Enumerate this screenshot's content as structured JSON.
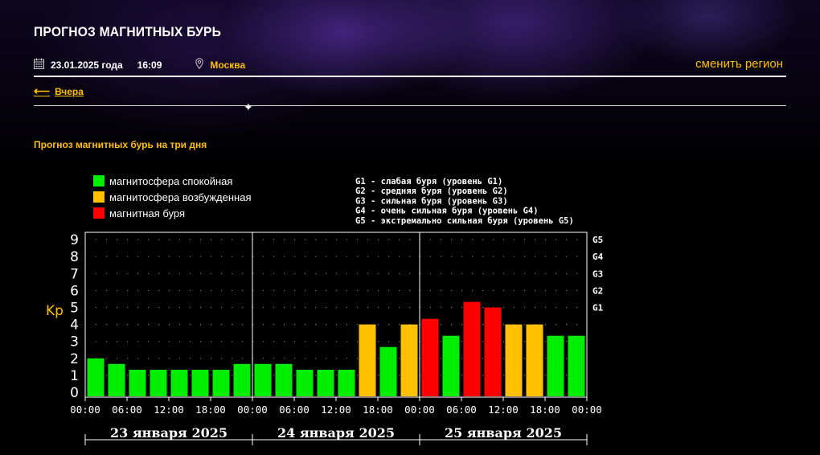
{
  "header": {
    "title": "ПРОГНОЗ МАГНИТНЫХ БУРЬ",
    "date": "23.01.2025 года",
    "time": "16:09",
    "city": "Москва",
    "change_region": "сменить регион",
    "back_label": "Вчера",
    "section_title": "Прогноз магнитных бурь на три дня"
  },
  "icons": {
    "calendar": "calendar-icon",
    "location": "location-pin-icon",
    "back": "left-arrow-icon"
  },
  "colors": {
    "accent": "#ffc000",
    "calm": "#00ee00",
    "excited": "#ffc000",
    "storm": "#ff0000"
  },
  "chart_data": {
    "type": "bar",
    "ylabel": "Kp",
    "ylim": [
      0,
      9
    ],
    "yticks": [
      "0",
      "1",
      "2",
      "3",
      "4",
      "5",
      "6",
      "7",
      "8",
      "9"
    ],
    "g_levels": [
      {
        "kp": 5,
        "label": "G1"
      },
      {
        "kp": 6,
        "label": "G2"
      },
      {
        "kp": 7,
        "label": "G3"
      },
      {
        "kp": 8,
        "label": "G4"
      },
      {
        "kp": 9,
        "label": "G5"
      }
    ],
    "legend": [
      {
        "label": "магнитосфера спокойная",
        "color": "#00ee00"
      },
      {
        "label": "магнитосфера возбужденная",
        "color": "#ffc000"
      },
      {
        "label": "магнитная буря",
        "color": "#ff0000"
      }
    ],
    "g_legend": [
      "G1 - слабая буря (уровень G1)",
      "G2 - средняя буря (уровень G2)",
      "G3 - сильная буря (уровень G3)",
      "G4 - очень сильная буря (уровень G4)",
      "G5 - экстремально сильная буря (уровень G5)"
    ],
    "x_tick_labels": [
      "00:00",
      "06:00",
      "12:00",
      "18:00",
      "00:00",
      "06:00",
      "12:00",
      "18:00",
      "00:00",
      "06:00",
      "12:00",
      "18:00",
      "00:00"
    ],
    "days": [
      "23 января 2025",
      "24 января 2025",
      "25 января 2025"
    ],
    "values": [
      2,
      1.67,
      1.33,
      1.33,
      1.33,
      1.33,
      1.33,
      1.67,
      1.67,
      1.67,
      1.33,
      1.33,
      1.33,
      4,
      2.67,
      4,
      4.33,
      3.33,
      5.33,
      5,
      4,
      4,
      3.33,
      3.33
    ],
    "status": [
      "calm",
      "calm",
      "calm",
      "calm",
      "calm",
      "calm",
      "calm",
      "calm",
      "calm",
      "calm",
      "calm",
      "calm",
      "calm",
      "excited",
      "calm",
      "excited",
      "storm",
      "calm",
      "storm",
      "storm",
      "excited",
      "excited",
      "calm",
      "calm"
    ],
    "grid": true
  }
}
